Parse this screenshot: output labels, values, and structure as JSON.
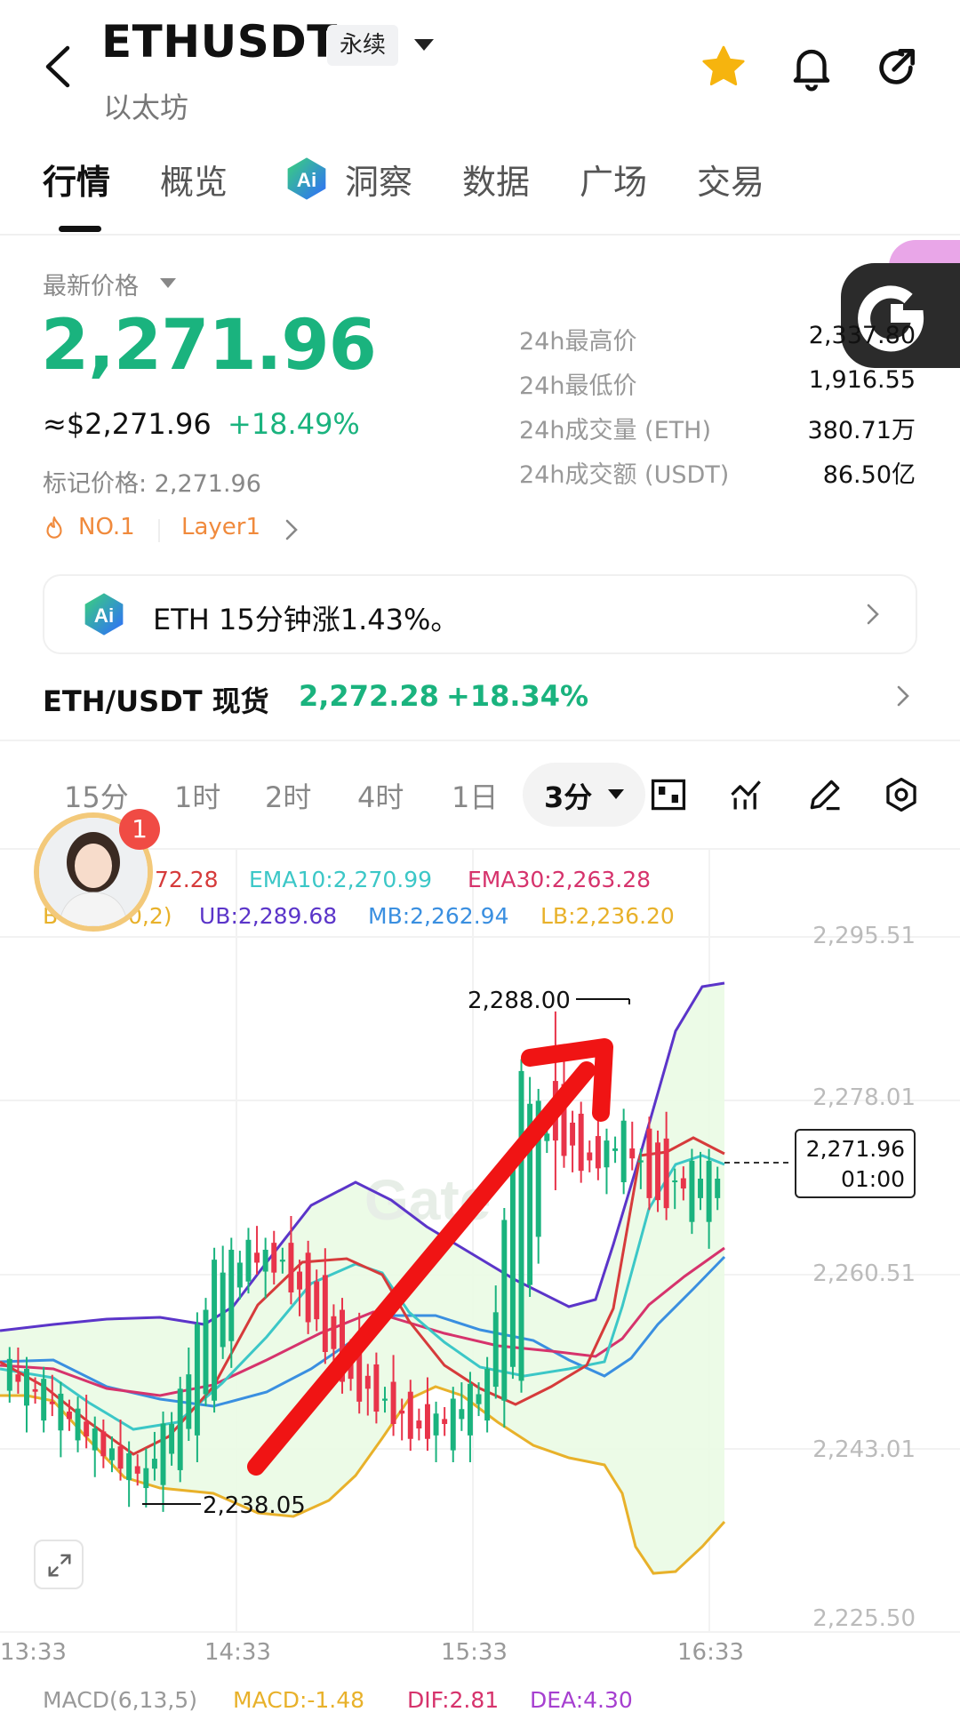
{
  "header": {
    "symbol": "ETHUSDT",
    "contract_type": "永续",
    "subtitle": "以太坊"
  },
  "tabs": [
    "行情",
    "概览",
    "洞察",
    "数据",
    "广场",
    "交易"
  ],
  "price": {
    "label": "最新价格",
    "last": "2,271.96",
    "usd": "≈$2,271.96",
    "change_pct": "+18.49%",
    "mark_price": "标记价格: 2,271.96",
    "tag_rank": "NO.1",
    "tag_category": "Layer1"
  },
  "stats": [
    {
      "label": "24h最高价",
      "value": "2,337.80"
    },
    {
      "label": "24h最低价",
      "value": "1,916.55"
    },
    {
      "label": "24h成交量 (ETH)",
      "value": "380.71万"
    },
    {
      "label": "24h成交额 (USDT)",
      "value": "86.50亿"
    }
  ],
  "ai_banner": {
    "text": "ETH 15分钟涨1.43%。"
  },
  "spot": {
    "label": "ETH/USDT 现货",
    "price": "2,272.28",
    "change_pct": "+18.34%"
  },
  "timeframes": [
    "15分",
    "1时",
    "2时",
    "4时",
    "1日"
  ],
  "selected_timeframe": "3分",
  "indicators": {
    "ema5": "72.28",
    "ema10": "EMA10:2,270.99",
    "ema30": "EMA30:2,263.28",
    "boll": "BO",
    "boll_param": "0,2)",
    "ub": "UB:2,289.68",
    "mb": "MB:2,262.94",
    "lb": "LB:2,236.20"
  },
  "notification_count": "1",
  "chart_data": {
    "type": "candlestick",
    "y_ticks": [
      "2,295.51",
      "2,278.01",
      "2,260.51",
      "2,243.01",
      "2,225.50"
    ],
    "x_ticks": [
      "13:33",
      "14:33",
      "15:33",
      "16:33"
    ],
    "ylim": [
      2225.5,
      2295.51
    ],
    "annotations": {
      "high": "2,288.00",
      "low": "2,238.05"
    },
    "current_price": "2,271.96",
    "countdown": "01:00",
    "watermark": "Gate",
    "colors": {
      "up": "#1ab37e",
      "down": "#e8344a",
      "ema5": "#d63b3b",
      "ema10": "#3cc7c7",
      "ema30": "#d6336c",
      "ub": "#5b35c9",
      "mb": "#3a8fe0",
      "lb": "#e8b12a",
      "arrow": "#f01414"
    },
    "candles_ohlc_sample": [
      [
        2251,
        2253,
        2249,
        2252
      ],
      [
        2248,
        2252,
        2246,
        2250
      ],
      [
        2246,
        2249,
        2244,
        2247
      ],
      [
        2244,
        2247,
        2240,
        2243
      ],
      [
        2240,
        2244,
        2238.05,
        2242
      ],
      [
        2243,
        2250,
        2242,
        2249
      ],
      [
        2250,
        2263,
        2249,
        2262
      ],
      [
        2262,
        2266,
        2259,
        2264
      ],
      [
        2264,
        2266,
        2260,
        2262
      ],
      [
        2262,
        2263,
        2255,
        2256
      ],
      [
        2255,
        2257,
        2248,
        2250
      ],
      [
        2250,
        2252,
        2246,
        2248
      ],
      [
        2248,
        2249,
        2243,
        2245
      ],
      [
        2245,
        2249,
        2244,
        2248
      ],
      [
        2248,
        2252,
        2247,
        2251
      ],
      [
        2252,
        2282,
        2251,
        2281
      ],
      [
        2281,
        2288,
        2270,
        2275
      ],
      [
        2275,
        2280,
        2268,
        2272
      ],
      [
        2272,
        2278,
        2269,
        2276
      ],
      [
        2276,
        2277,
        2266,
        2268
      ],
      [
        2268,
        2273,
        2266,
        2271.96
      ]
    ]
  },
  "macd": {
    "label": "MACD(6,13,5)",
    "macd": "MACD:-1.48",
    "dif": "DIF:2.81",
    "dea": "DEA:4.30"
  }
}
